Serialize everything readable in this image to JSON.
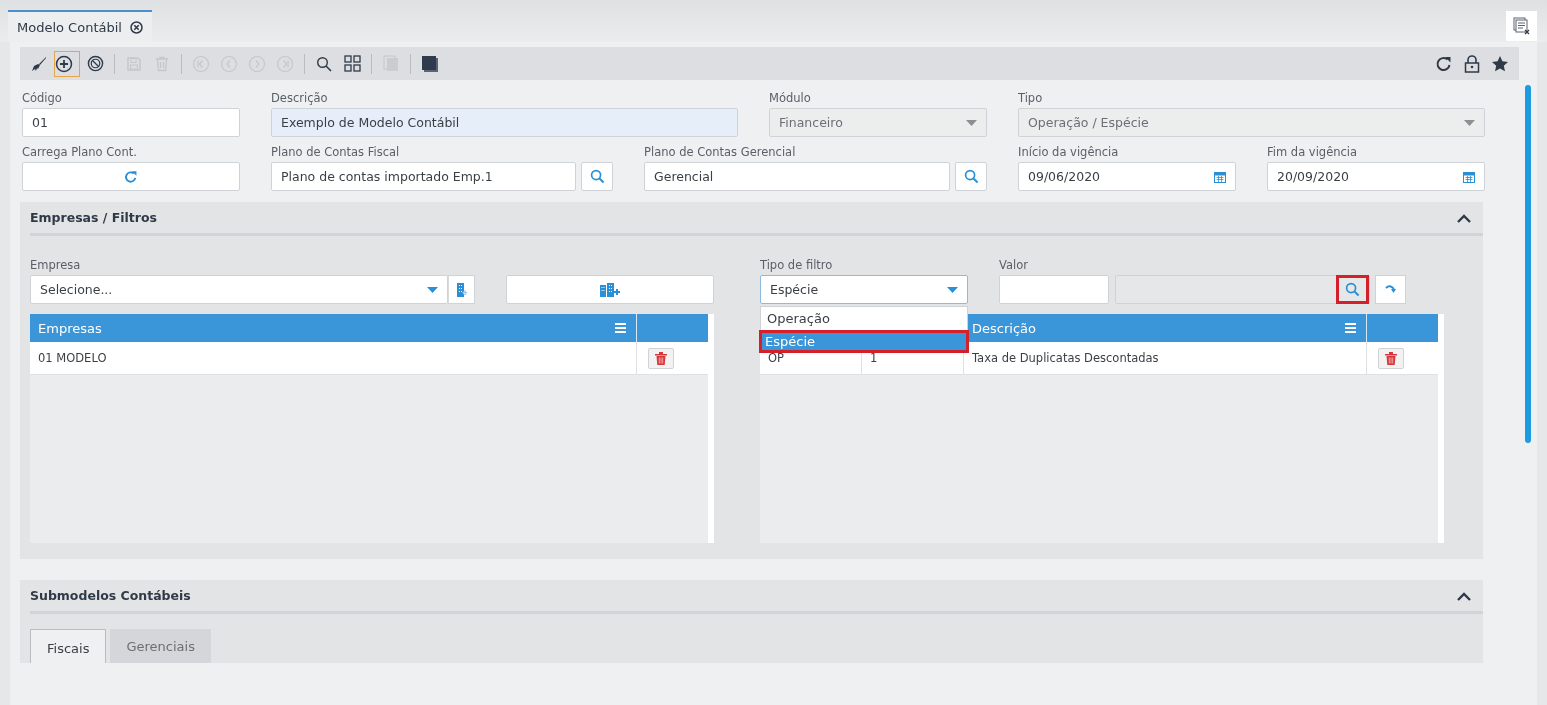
{
  "tab": {
    "title": "Modelo Contábil",
    "selected": true
  },
  "toolbar": {
    "left": [
      {
        "kind": "brush",
        "disabled": false,
        "selected": false
      },
      {
        "kind": "add",
        "disabled": false,
        "selected": true
      },
      {
        "kind": "cancel",
        "disabled": false,
        "selected": false
      },
      {
        "kind": "sep"
      },
      {
        "kind": "save",
        "disabled": true,
        "selected": false
      },
      {
        "kind": "delete",
        "disabled": true,
        "selected": false
      },
      {
        "kind": "sep"
      },
      {
        "kind": "first",
        "disabled": true,
        "selected": false
      },
      {
        "kind": "prev",
        "disabled": true,
        "selected": false
      },
      {
        "kind": "next",
        "disabled": true,
        "selected": false
      },
      {
        "kind": "last",
        "disabled": true,
        "selected": false
      },
      {
        "kind": "sep"
      },
      {
        "kind": "search",
        "disabled": false,
        "selected": false
      },
      {
        "kind": "grid",
        "disabled": false,
        "selected": false
      },
      {
        "kind": "sep"
      },
      {
        "kind": "copy",
        "disabled": true,
        "selected": false
      },
      {
        "kind": "sep"
      },
      {
        "kind": "stack",
        "disabled": false,
        "selected": false
      }
    ],
    "right": [
      {
        "kind": "refresh",
        "disabled": false,
        "selected": false
      },
      {
        "kind": "lock",
        "disabled": false,
        "selected": false
      },
      {
        "kind": "star",
        "disabled": false,
        "selected": false
      }
    ]
  },
  "form_rows": [
    [
      {
        "label": "Código",
        "kind": "text",
        "value": "01",
        "focused": false
      },
      {
        "label": "Descrição",
        "kind": "text",
        "value": "Exemplo de Modelo Contábil",
        "focused": true
      },
      {
        "label": "Módulo",
        "kind": "select",
        "value": "Financeiro",
        "disabled": true
      },
      {
        "label": "Tipo",
        "kind": "select",
        "value": "Operação / Espécie",
        "disabled": true
      }
    ],
    [
      {
        "label": "Carrega Plano Cont.",
        "kind": "button"
      },
      {
        "label": "Plano de Contas Fiscal",
        "kind": "lookup",
        "value": "Plano de contas importado Emp.1"
      },
      {
        "label": "Plano de Contas Gerencial",
        "kind": "lookup",
        "value": "Gerencial"
      },
      {
        "label": "Início da vigência",
        "kind": "date",
        "value": "09/06/2020"
      },
      {
        "label": "Fim da vigência",
        "kind": "date",
        "value": "20/09/2020"
      }
    ]
  ],
  "empresas_filtros": {
    "title": "Empresas / Filtros",
    "expanded": true,
    "empresa": {
      "label": "Empresa",
      "placeholder": "Selecione..."
    },
    "tipo_filtro": {
      "label": "Tipo de filtro",
      "value": "Espécie",
      "open": true,
      "options": [
        {
          "label": "Operação",
          "selected": false,
          "highlighted": false
        },
        {
          "label": "Espécie",
          "selected": true,
          "highlighted": true
        }
      ]
    },
    "valor": {
      "label": "Valor",
      "search_highlighted": true
    },
    "empresas_table": {
      "columns": [
        "Empresas"
      ],
      "rows": [
        {
          "cells": [
            "01 MODELO"
          ]
        }
      ]
    },
    "filtros_table": {
      "columns": [
        "",
        "",
        "Descrição"
      ],
      "rows": [
        {
          "cells": [
            "OP",
            "1",
            "Taxa de Duplicatas Descontadas"
          ]
        }
      ]
    }
  },
  "submodelos": {
    "title": "Submodelos Contábeis",
    "expanded": true,
    "tabs": [
      {
        "label": "Fiscais",
        "selected": true
      },
      {
        "label": "Gerenciais",
        "selected": false
      }
    ]
  }
}
